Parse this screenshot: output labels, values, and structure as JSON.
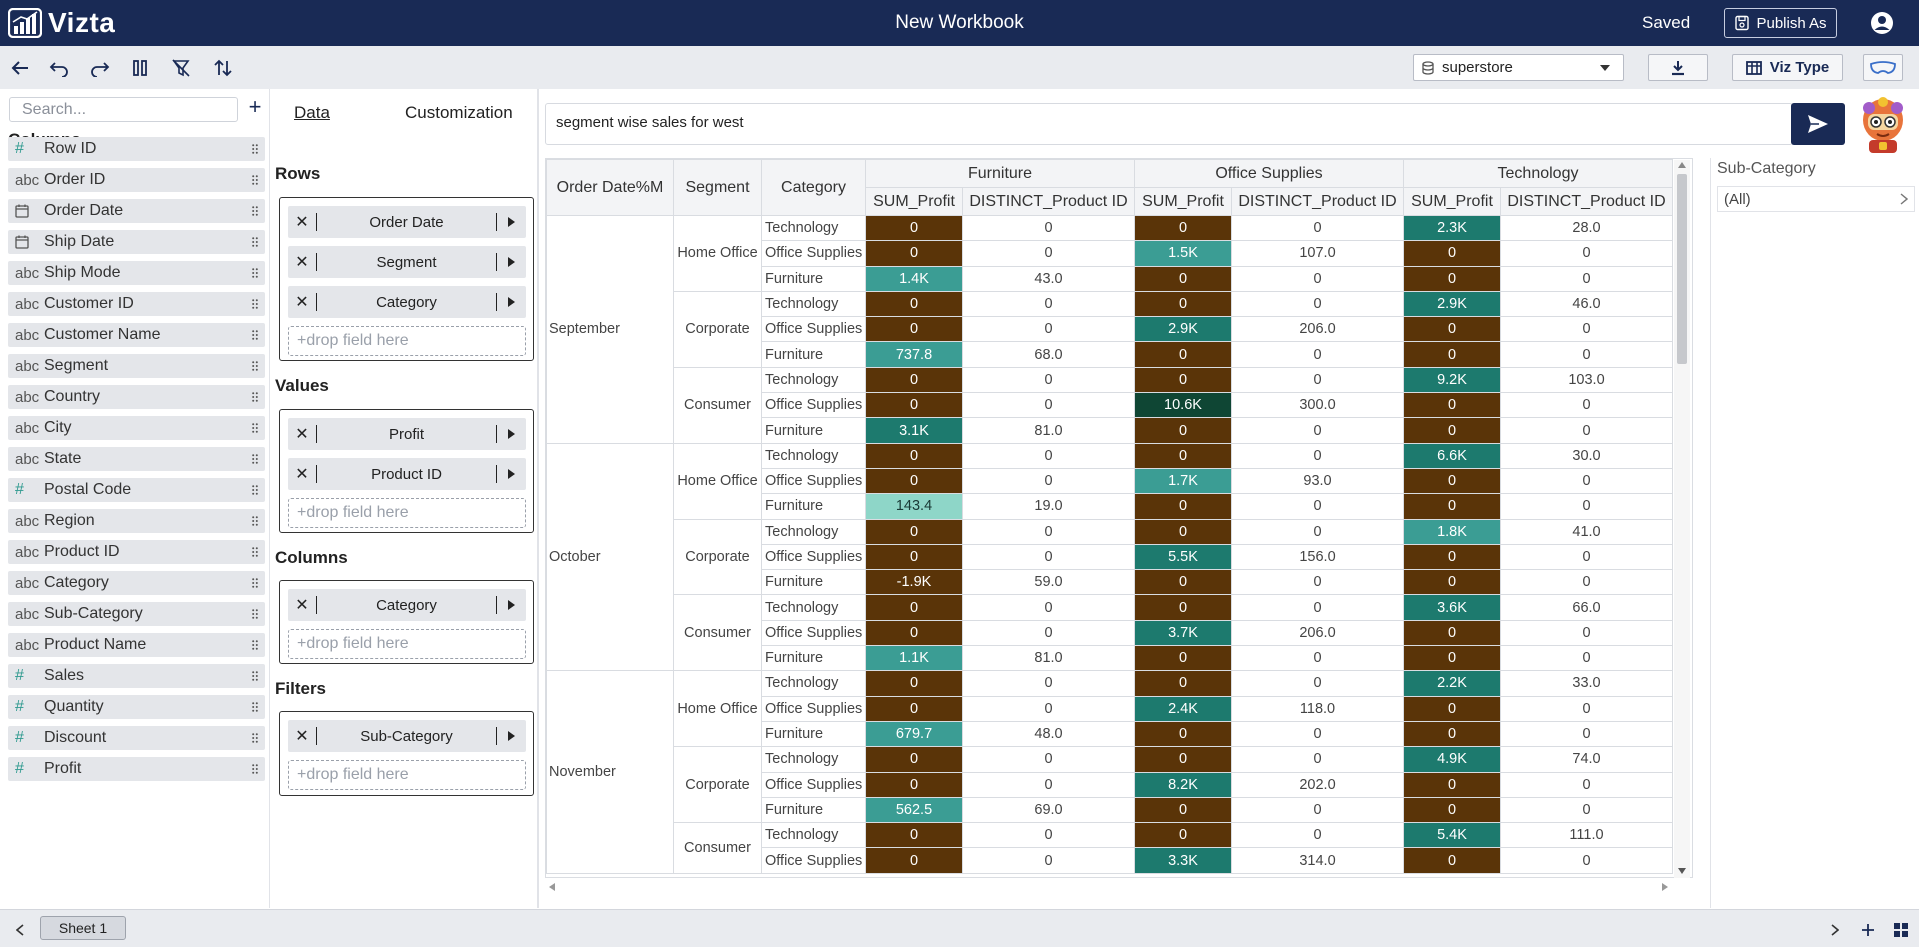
{
  "app": {
    "name": "Vizta",
    "workbook_title": "New Workbook",
    "save_status": "Saved",
    "publish_label": "Publish As"
  },
  "toolbar": {
    "datasource": "superstore",
    "viz_type_label": "Viz Type"
  },
  "fields": {
    "search_placeholder": "Search...",
    "columns_heading": "Columns",
    "items": [
      {
        "type": "#",
        "name": "Row ID"
      },
      {
        "type": "abc",
        "name": "Order ID"
      },
      {
        "type": "date",
        "name": "Order Date"
      },
      {
        "type": "date",
        "name": "Ship Date"
      },
      {
        "type": "abc",
        "name": "Ship Mode"
      },
      {
        "type": "abc",
        "name": "Customer ID"
      },
      {
        "type": "abc",
        "name": "Customer Name"
      },
      {
        "type": "abc",
        "name": "Segment"
      },
      {
        "type": "abc",
        "name": "Country"
      },
      {
        "type": "abc",
        "name": "City"
      },
      {
        "type": "abc",
        "name": "State"
      },
      {
        "type": "#",
        "name": "Postal Code"
      },
      {
        "type": "abc",
        "name": "Region"
      },
      {
        "type": "abc",
        "name": "Product ID"
      },
      {
        "type": "abc",
        "name": "Category"
      },
      {
        "type": "abc",
        "name": "Sub-Category"
      },
      {
        "type": "abc",
        "name": "Product Name"
      },
      {
        "type": "#",
        "name": "Sales"
      },
      {
        "type": "#",
        "name": "Quantity"
      },
      {
        "type": "#",
        "name": "Discount"
      },
      {
        "type": "#",
        "name": "Profit"
      }
    ]
  },
  "config": {
    "tabs": {
      "data": "Data",
      "customization": "Customization"
    },
    "drop_hint": "drop field here",
    "rows": {
      "title": "Rows",
      "pills": [
        "Order Date",
        "Segment",
        "Category"
      ]
    },
    "values": {
      "title": "Values",
      "pills": [
        "Profit",
        "Product ID"
      ]
    },
    "columns": {
      "title": "Columns",
      "pills": [
        "Category"
      ]
    },
    "filters": {
      "title": "Filters",
      "pills": [
        "Sub-Category"
      ]
    }
  },
  "prompt": {
    "text": "segment wise sales for west"
  },
  "table": {
    "row_headers": [
      "Order Date%M",
      "Segment",
      "Category"
    ],
    "column_groups": [
      "Furniture",
      "Office Supplies",
      "Technology"
    ],
    "measures": [
      "SUM_Profit",
      "DISTINCT_Product ID"
    ],
    "months": [
      {
        "name": "September",
        "segments": [
          {
            "name": "Home Office",
            "rows": [
              {
                "cat": "Technology",
                "v": [
                  "0",
                  "0",
                  "0",
                  "0",
                  "2.3K",
                  "28.0"
                ]
              },
              {
                "cat": "Office Supplies",
                "v": [
                  "0",
                  "0",
                  "1.5K",
                  "107.0",
                  "0",
                  "0"
                ]
              },
              {
                "cat": "Furniture",
                "v": [
                  "1.4K",
                  "43.0",
                  "0",
                  "0",
                  "0",
                  "0"
                ]
              }
            ]
          },
          {
            "name": "Corporate",
            "rows": [
              {
                "cat": "Technology",
                "v": [
                  "0",
                  "0",
                  "0",
                  "0",
                  "2.9K",
                  "46.0"
                ]
              },
              {
                "cat": "Office Supplies",
                "v": [
                  "0",
                  "0",
                  "2.9K",
                  "206.0",
                  "0",
                  "0"
                ]
              },
              {
                "cat": "Furniture",
                "v": [
                  "737.8",
                  "68.0",
                  "0",
                  "0",
                  "0",
                  "0"
                ]
              }
            ]
          },
          {
            "name": "Consumer",
            "rows": [
              {
                "cat": "Technology",
                "v": [
                  "0",
                  "0",
                  "0",
                  "0",
                  "9.2K",
                  "103.0"
                ]
              },
              {
                "cat": "Office Supplies",
                "v": [
                  "0",
                  "0",
                  "10.6K",
                  "300.0",
                  "0",
                  "0"
                ]
              },
              {
                "cat": "Furniture",
                "v": [
                  "3.1K",
                  "81.0",
                  "0",
                  "0",
                  "0",
                  "0"
                ]
              }
            ]
          }
        ]
      },
      {
        "name": "October",
        "segments": [
          {
            "name": "Home Office",
            "rows": [
              {
                "cat": "Technology",
                "v": [
                  "0",
                  "0",
                  "0",
                  "0",
                  "6.6K",
                  "30.0"
                ]
              },
              {
                "cat": "Office Supplies",
                "v": [
                  "0",
                  "0",
                  "1.7K",
                  "93.0",
                  "0",
                  "0"
                ]
              },
              {
                "cat": "Furniture",
                "v": [
                  "143.4",
                  "19.0",
                  "0",
                  "0",
                  "0",
                  "0"
                ]
              }
            ]
          },
          {
            "name": "Corporate",
            "rows": [
              {
                "cat": "Technology",
                "v": [
                  "0",
                  "0",
                  "0",
                  "0",
                  "1.8K",
                  "41.0"
                ]
              },
              {
                "cat": "Office Supplies",
                "v": [
                  "0",
                  "0",
                  "5.5K",
                  "156.0",
                  "0",
                  "0"
                ]
              },
              {
                "cat": "Furniture",
                "v": [
                  "-1.9K",
                  "59.0",
                  "0",
                  "0",
                  "0",
                  "0"
                ]
              }
            ]
          },
          {
            "name": "Consumer",
            "rows": [
              {
                "cat": "Technology",
                "v": [
                  "0",
                  "0",
                  "0",
                  "0",
                  "3.6K",
                  "66.0"
                ]
              },
              {
                "cat": "Office Supplies",
                "v": [
                  "0",
                  "0",
                  "3.7K",
                  "206.0",
                  "0",
                  "0"
                ]
              },
              {
                "cat": "Furniture",
                "v": [
                  "1.1K",
                  "81.0",
                  "0",
                  "0",
                  "0",
                  "0"
                ]
              }
            ]
          }
        ]
      },
      {
        "name": "November",
        "segments": [
          {
            "name": "Home Office",
            "rows": [
              {
                "cat": "Technology",
                "v": [
                  "0",
                  "0",
                  "0",
                  "0",
                  "2.2K",
                  "33.0"
                ]
              },
              {
                "cat": "Office Supplies",
                "v": [
                  "0",
                  "0",
                  "2.4K",
                  "118.0",
                  "0",
                  "0"
                ]
              },
              {
                "cat": "Furniture",
                "v": [
                  "679.7",
                  "48.0",
                  "0",
                  "0",
                  "0",
                  "0"
                ]
              }
            ]
          },
          {
            "name": "Corporate",
            "rows": [
              {
                "cat": "Technology",
                "v": [
                  "0",
                  "0",
                  "0",
                  "0",
                  "4.9K",
                  "74.0"
                ]
              },
              {
                "cat": "Office Supplies",
                "v": [
                  "0",
                  "0",
                  "8.2K",
                  "202.0",
                  "0",
                  "0"
                ]
              },
              {
                "cat": "Furniture",
                "v": [
                  "562.5",
                  "69.0",
                  "0",
                  "0",
                  "0",
                  "0"
                ]
              }
            ]
          },
          {
            "name": "Consumer",
            "rows": [
              {
                "cat": "Technology",
                "v": [
                  "0",
                  "0",
                  "0",
                  "0",
                  "5.4K",
                  "111.0"
                ]
              },
              {
                "cat": "Office Supplies",
                "v": [
                  "0",
                  "0",
                  "3.3K",
                  "314.0",
                  "0",
                  "0"
                ]
              }
            ]
          }
        ]
      }
    ]
  },
  "filter": {
    "label": "Sub-Category",
    "value": "(All)"
  },
  "bottom": {
    "sheet_tab": "Sheet 1"
  },
  "colors": {
    "brand": "#192a55",
    "zero_cell": "#5a3408",
    "low_cell": "#8ed6c8",
    "mid_cell": "#3b9d94",
    "high_cell": "#1d7a6e",
    "peak_cell": "#0f4634"
  }
}
